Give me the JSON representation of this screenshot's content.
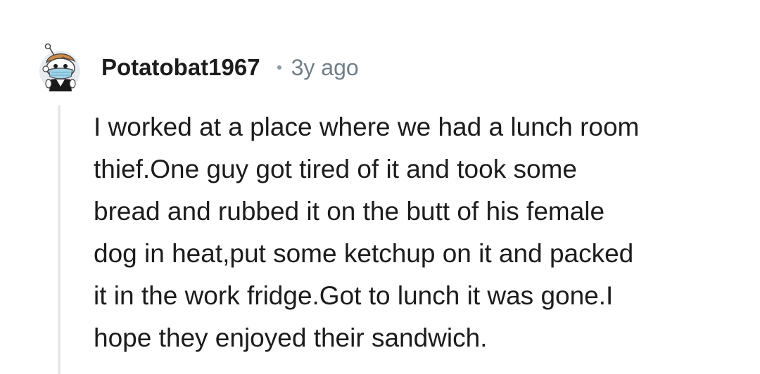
{
  "comment": {
    "author": "Potatobat1967",
    "separator": "•",
    "age": "3y ago",
    "body_lines": [
      "I worked at a place where we had a lunch room",
      "thief.One guy got tired of it and took some",
      "bread and rubbed it on the butt of his female",
      "dog in heat,put some ketchup on it and packed",
      "it in the work fridge.Got to lunch it was gone.I",
      "hope they enjoyed their sandwich."
    ],
    "avatar_icon": "snoo-avatar-with-face-mask-icon"
  },
  "colors": {
    "background": "#ffffff",
    "text": "#1c1c1c",
    "meta": "#6f7f89",
    "thread_line": "#e6e6e6"
  }
}
